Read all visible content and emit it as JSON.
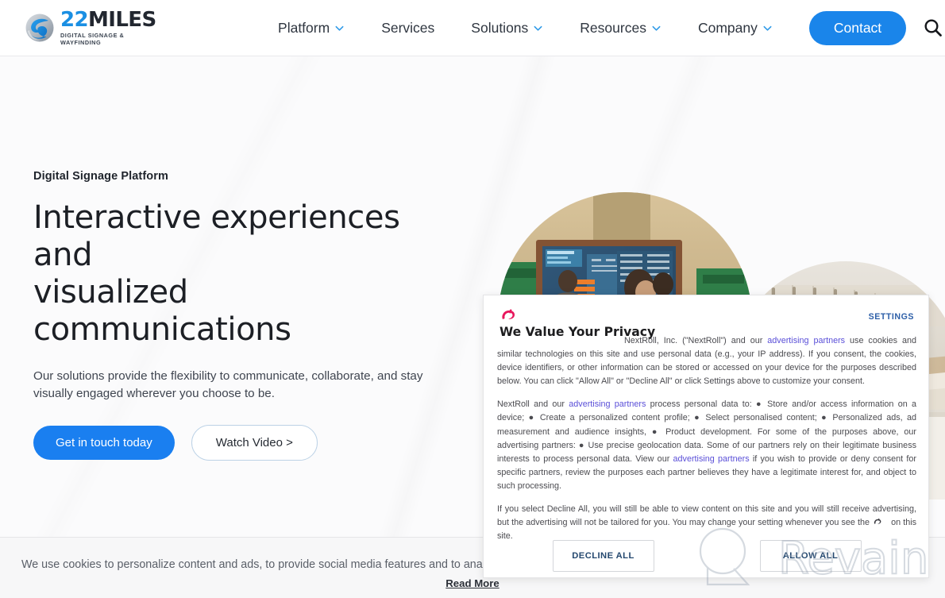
{
  "header": {
    "logo": {
      "icon": "22miles-sphere-logo",
      "word_primary": "22",
      "word_secondary": "MILES",
      "tagline": "DIGITAL SIGNAGE & WAYFINDING",
      "color_primary": "#1a8fe3",
      "color_secondary": "#222730"
    },
    "nav": [
      {
        "label": "Platform",
        "has_dropdown": true,
        "icon": "chevron-down-icon"
      },
      {
        "label": "Services",
        "has_dropdown": false,
        "icon": ""
      },
      {
        "label": "Solutions",
        "has_dropdown": true,
        "icon": "chevron-down-icon"
      },
      {
        "label": "Resources",
        "has_dropdown": true,
        "icon": "chevron-down-icon"
      },
      {
        "label": "Company",
        "has_dropdown": true,
        "icon": "chevron-down-icon"
      }
    ],
    "contact_label": "Contact",
    "contact_color": "#1a85ea",
    "search_icon": "search-icon"
  },
  "hero": {
    "eyebrow": "Digital Signage Platform",
    "headline_line_1": "Interactive experiences and",
    "headline_line_2": "visualized communications",
    "subhead": "Our solutions provide the flexibility to communicate, collaborate, and stay visually engaged wherever you choose to be.",
    "cta_primary": "Get in touch today",
    "cta_secondary": "Watch Video >",
    "cta_primary_color": "#1a7ff0",
    "image_front_alt": "people-viewing-digital-signage-display",
    "image_back_alt": "modern-lobby-wood-ceiling"
  },
  "cookie_bar": {
    "text": "We use cookies to personalize content and ads, to provide social media features and to ana",
    "read_more": "Read More"
  },
  "privacy_dialog": {
    "brand_icon": "nextroll-logo-icon",
    "brand_color": "#e8175d",
    "title": "We Value Your Privacy",
    "settings_label": "SETTINGS",
    "settings_color": "#2d5fa8",
    "paragraph_1_a": "NextRoll, Inc. (\"NextRoll\") and our ",
    "paragraph_1_link": "advertising partners",
    "paragraph_1_b": " use cookies and similar technologies on this site and use personal data (e.g., your IP address). If you consent, the cookies, device identifiers, or other information can be stored or accessed on your device for the purposes described below. You can click \"Allow All\" or \"Decline All\" or click Settings above to customize your consent.",
    "paragraph_2_a": "NextRoll and our ",
    "paragraph_2_link_1": "advertising partners",
    "paragraph_2_b": " process personal data to: ● Store and/or access information on a device; ● Create a personalized content profile; ● Select personalised content; ● Personalized ads, ad measurement and audience insights, ● Product development. For some of the purposes above, our advertising partners: ● Use precise geolocation data. Some of our partners rely on their legitimate business interests to process personal data. View our ",
    "paragraph_2_link_2": "advertising partners",
    "paragraph_2_c": " if you wish to provide or deny consent for specific partners, review the purposes each partner believes they have a legitimate interest for, and object to such processing.",
    "paragraph_3_a": "If you select Decline All, you will still be able to view content on this site and you will still receive advertising, but the advertising will not be tailored for you. You may change your setting whenever you see the",
    "paragraph_3_icon": "nextroll-settings-icon",
    "paragraph_3_b": "on this site.",
    "decline_label": "DECLINE ALL",
    "allow_label": "ALLOW ALL",
    "button_text_color": "#24486f"
  },
  "watermark": {
    "text": "Revain",
    "icon": "revain-magnifier-logo"
  }
}
